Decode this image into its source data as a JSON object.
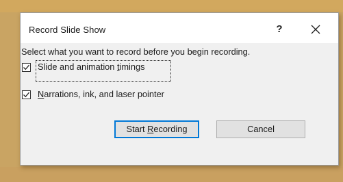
{
  "dialog": {
    "title": "Record Slide Show",
    "help_label": "?",
    "close_icon": "close-icon",
    "prompt": "Select what you want to record before you begin recording.",
    "options": [
      {
        "label_pre": "Slide and animation ",
        "label_accel": "t",
        "label_post": "imings",
        "checked": true
      },
      {
        "label_pre": "",
        "label_accel": "N",
        "label_post": "arrations, ink, and laser pointer",
        "checked": true
      }
    ],
    "start_button": {
      "label_pre": "Start ",
      "label_accel": "R",
      "label_post": "ecording"
    },
    "cancel_button": {
      "label": "Cancel"
    }
  },
  "colors": {
    "backdrop": "#c9a463",
    "focus_border": "#0078d7",
    "body_bg": "#f0f0f0",
    "button_bg": "#e1e1e1"
  }
}
